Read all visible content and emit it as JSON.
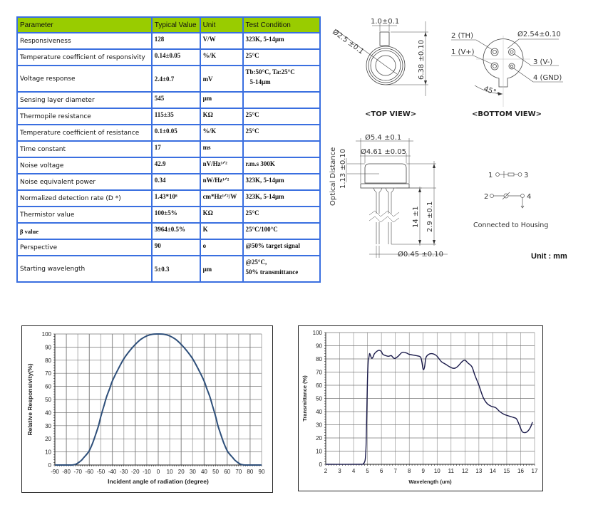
{
  "spec_table": {
    "headers": {
      "parameter": "Parameter",
      "typical_value": "Typical Value",
      "unit": "Unit",
      "test_condition": "Test Condition"
    },
    "header_color": "#99cc00",
    "border_color": "#3a6fe0",
    "rows": [
      {
        "parameter": "Responsiveness",
        "value": "128",
        "unit": "V/W",
        "condition": "323K, 5-14μm",
        "condition2": ""
      },
      {
        "parameter": "Temperature coefficient of responsivity",
        "value": "0.14±0.05",
        "unit": "%/K",
        "condition": "25°C",
        "condition2": ""
      },
      {
        "parameter": "Voltage response",
        "value": "2.4±0.7",
        "unit": "mV",
        "condition": "Tb:50°C, Ta:25°C",
        "condition2": "5-14μm"
      },
      {
        "parameter": "Sensing layer diameter",
        "value": "545",
        "unit": "μm",
        "condition": "",
        "condition2": ""
      },
      {
        "parameter": "Thermopile resistance",
        "value": "115±35",
        "unit": "KΩ",
        "condition": "25°C",
        "condition2": ""
      },
      {
        "parameter": "Temperature coefficient of resistance",
        "value": "0.1±0.05",
        "unit": "%/K",
        "condition": "25°C",
        "condition2": ""
      },
      {
        "parameter": "Time constant",
        "value": "17",
        "unit": "ms",
        "condition": "",
        "condition2": ""
      },
      {
        "parameter": "Noise voltage",
        "value": "42.9",
        "unit": "nV/Hz¹ᐟ²",
        "condition": "r.m.s 300K",
        "condition2": ""
      },
      {
        "parameter": "Noise equivalent power",
        "value": "0.34",
        "unit": "nW/Hz¹ᐟ²",
        "condition": "323K, 5-14μm",
        "condition2": ""
      },
      {
        "parameter": "Normalized detection rate (D *)",
        "value": "1.43*10⁸",
        "unit": "cm*Hz¹ᐟ²/W",
        "condition": "323K, 5-14μm",
        "condition2": ""
      },
      {
        "parameter": "Thermistor value",
        "value": "100±5%",
        "unit": "KΩ",
        "condition": "25°C",
        "condition2": ""
      },
      {
        "parameter": "β value",
        "value": "3964±0.5%",
        "unit": "K",
        "condition": "25°C/100°C",
        "condition2": ""
      },
      {
        "parameter": "Perspective",
        "value": "90",
        "unit": "o",
        "condition": "@50% target signal",
        "condition2": ""
      },
      {
        "parameter": "Starting wavelength",
        "value": "5±0.3",
        "unit": "μm",
        "condition": "@25°C,",
        "condition2": "50% transmittance"
      }
    ]
  },
  "drawings": {
    "top_view": {
      "label": "<TOP VIEW>",
      "dim_tab_width": "1.0±0.1",
      "dim_diameter": "Ø2.5 ±0.1",
      "dim_height": "6.38 ±0.10"
    },
    "bottom_view": {
      "label": "<BOTTOM VIEW>",
      "dim_pin_circle": "Ø2.54±0.10",
      "angle": "45°",
      "pins": [
        {
          "label": "2 (TH)"
        },
        {
          "label": "1 (V+)"
        },
        {
          "label": "3 (V-)"
        },
        {
          "label": "4 (GND)"
        }
      ]
    },
    "side_view": {
      "dim_flange_diameter": "Ø5.4 ±0.1",
      "dim_can_diameter": "Ø4.61 ±0.05",
      "optical_distance_label": "Optical Distance",
      "optical_distance_value": "1.13 ±0.10",
      "dim_lead_length": "14 ±1",
      "dim_body_height": "2.9 ±0.1",
      "dim_lead_diameter": "Ø0.45 ±0.10"
    },
    "schematic": {
      "line1_left": "1",
      "line1_right": "3",
      "line2_left": "2",
      "line2_right": "4",
      "caption": "Connected to Housing"
    },
    "unit_note": "Unit : mm"
  },
  "chart_data": [
    {
      "type": "line",
      "title": "",
      "xlabel": "Incident angle of radiation  (degree)",
      "ylabel": "Relative Responsivity(%)",
      "xlim": [
        -90,
        90
      ],
      "ylim": [
        0,
        100
      ],
      "xticks": [
        -90,
        -80,
        -70,
        -60,
        -50,
        -40,
        -30,
        -20,
        -10,
        0,
        10,
        20,
        30,
        40,
        50,
        60,
        70,
        80,
        90
      ],
      "yticks": [
        0,
        10,
        20,
        30,
        40,
        50,
        60,
        70,
        80,
        90,
        100
      ],
      "grid": true,
      "legend": "none",
      "line_color": "#2e4f7a",
      "series": [
        {
          "name": "Relative Responsivity",
          "x": [
            -90,
            -80,
            -75,
            -72,
            -70,
            -67,
            -65,
            -62,
            -60,
            -57,
            -55,
            -52,
            -50,
            -47,
            -45,
            -42,
            -40,
            -35,
            -30,
            -25,
            -20,
            -15,
            -10,
            -5,
            0,
            5,
            10,
            15,
            20,
            25,
            30,
            35,
            40,
            42,
            45,
            47,
            50,
            52,
            55,
            57,
            60,
            62,
            65,
            67,
            70,
            72,
            75,
            80,
            90
          ],
          "y": [
            0,
            0,
            0,
            0.5,
            1.5,
            3.5,
            5.5,
            8.5,
            11,
            17,
            22,
            30,
            37,
            46,
            52,
            59,
            64,
            73,
            81,
            87,
            92,
            96,
            98.5,
            99.8,
            100,
            99.8,
            98.5,
            96,
            92,
            87,
            81,
            73,
            64,
            59,
            52,
            46,
            37,
            30,
            22,
            17,
            11,
            8.5,
            5.5,
            3.5,
            1.5,
            0.5,
            0,
            0,
            0
          ]
        }
      ]
    },
    {
      "type": "line",
      "title": "",
      "xlabel": "Wavelength (um)",
      "ylabel": "Transmittance (%)",
      "xlim": [
        2,
        17
      ],
      "ylim": [
        0,
        100
      ],
      "xticks": [
        2,
        3,
        4,
        5,
        6,
        7,
        8,
        9,
        10,
        11,
        12,
        13,
        14,
        15,
        16,
        17
      ],
      "yticks": [
        0,
        10,
        20,
        30,
        40,
        50,
        60,
        70,
        80,
        90,
        100
      ],
      "grid": true,
      "legend": "none",
      "line_color": "#1a1a4a",
      "series": [
        {
          "name": "Transmittance",
          "x": [
            2,
            4.5,
            4.7,
            4.8,
            4.85,
            4.9,
            4.95,
            5.0,
            5.05,
            5.1,
            5.15,
            5.2,
            5.3,
            5.4,
            5.5,
            5.7,
            5.85,
            6.0,
            6.1,
            6.3,
            6.5,
            6.7,
            6.8,
            6.9,
            7.0,
            7.2,
            7.5,
            7.8,
            8.0,
            8.5,
            8.8,
            8.9,
            9.0,
            9.1,
            9.2,
            9.4,
            9.6,
            9.8,
            10.0,
            10.3,
            10.6,
            10.9,
            11.1,
            11.3,
            11.5,
            11.8,
            12.0,
            12.2,
            12.5,
            12.7,
            13.0,
            13.3,
            13.6,
            13.9,
            14.2,
            14.5,
            14.8,
            15.2,
            15.5,
            15.7,
            15.9,
            16.1,
            16.3,
            16.5,
            16.7,
            16.85
          ],
          "y": [
            0,
            0,
            0.5,
            2,
            5,
            15,
            40,
            65,
            78,
            81,
            84,
            83,
            80.5,
            81.5,
            84,
            86,
            86.5,
            85.5,
            83.5,
            82.5,
            82,
            82.5,
            81.5,
            80.5,
            80.5,
            82,
            85,
            84.5,
            83.5,
            82.5,
            81.5,
            78,
            72,
            74,
            81,
            83.5,
            84,
            83.5,
            82,
            78,
            76,
            74,
            73,
            73,
            74.5,
            78,
            79,
            77,
            74,
            68,
            60,
            51,
            46,
            44,
            43,
            40,
            38,
            36.5,
            35.5,
            34.5,
            30,
            25,
            24,
            25,
            28,
            32
          ]
        }
      ]
    }
  ]
}
